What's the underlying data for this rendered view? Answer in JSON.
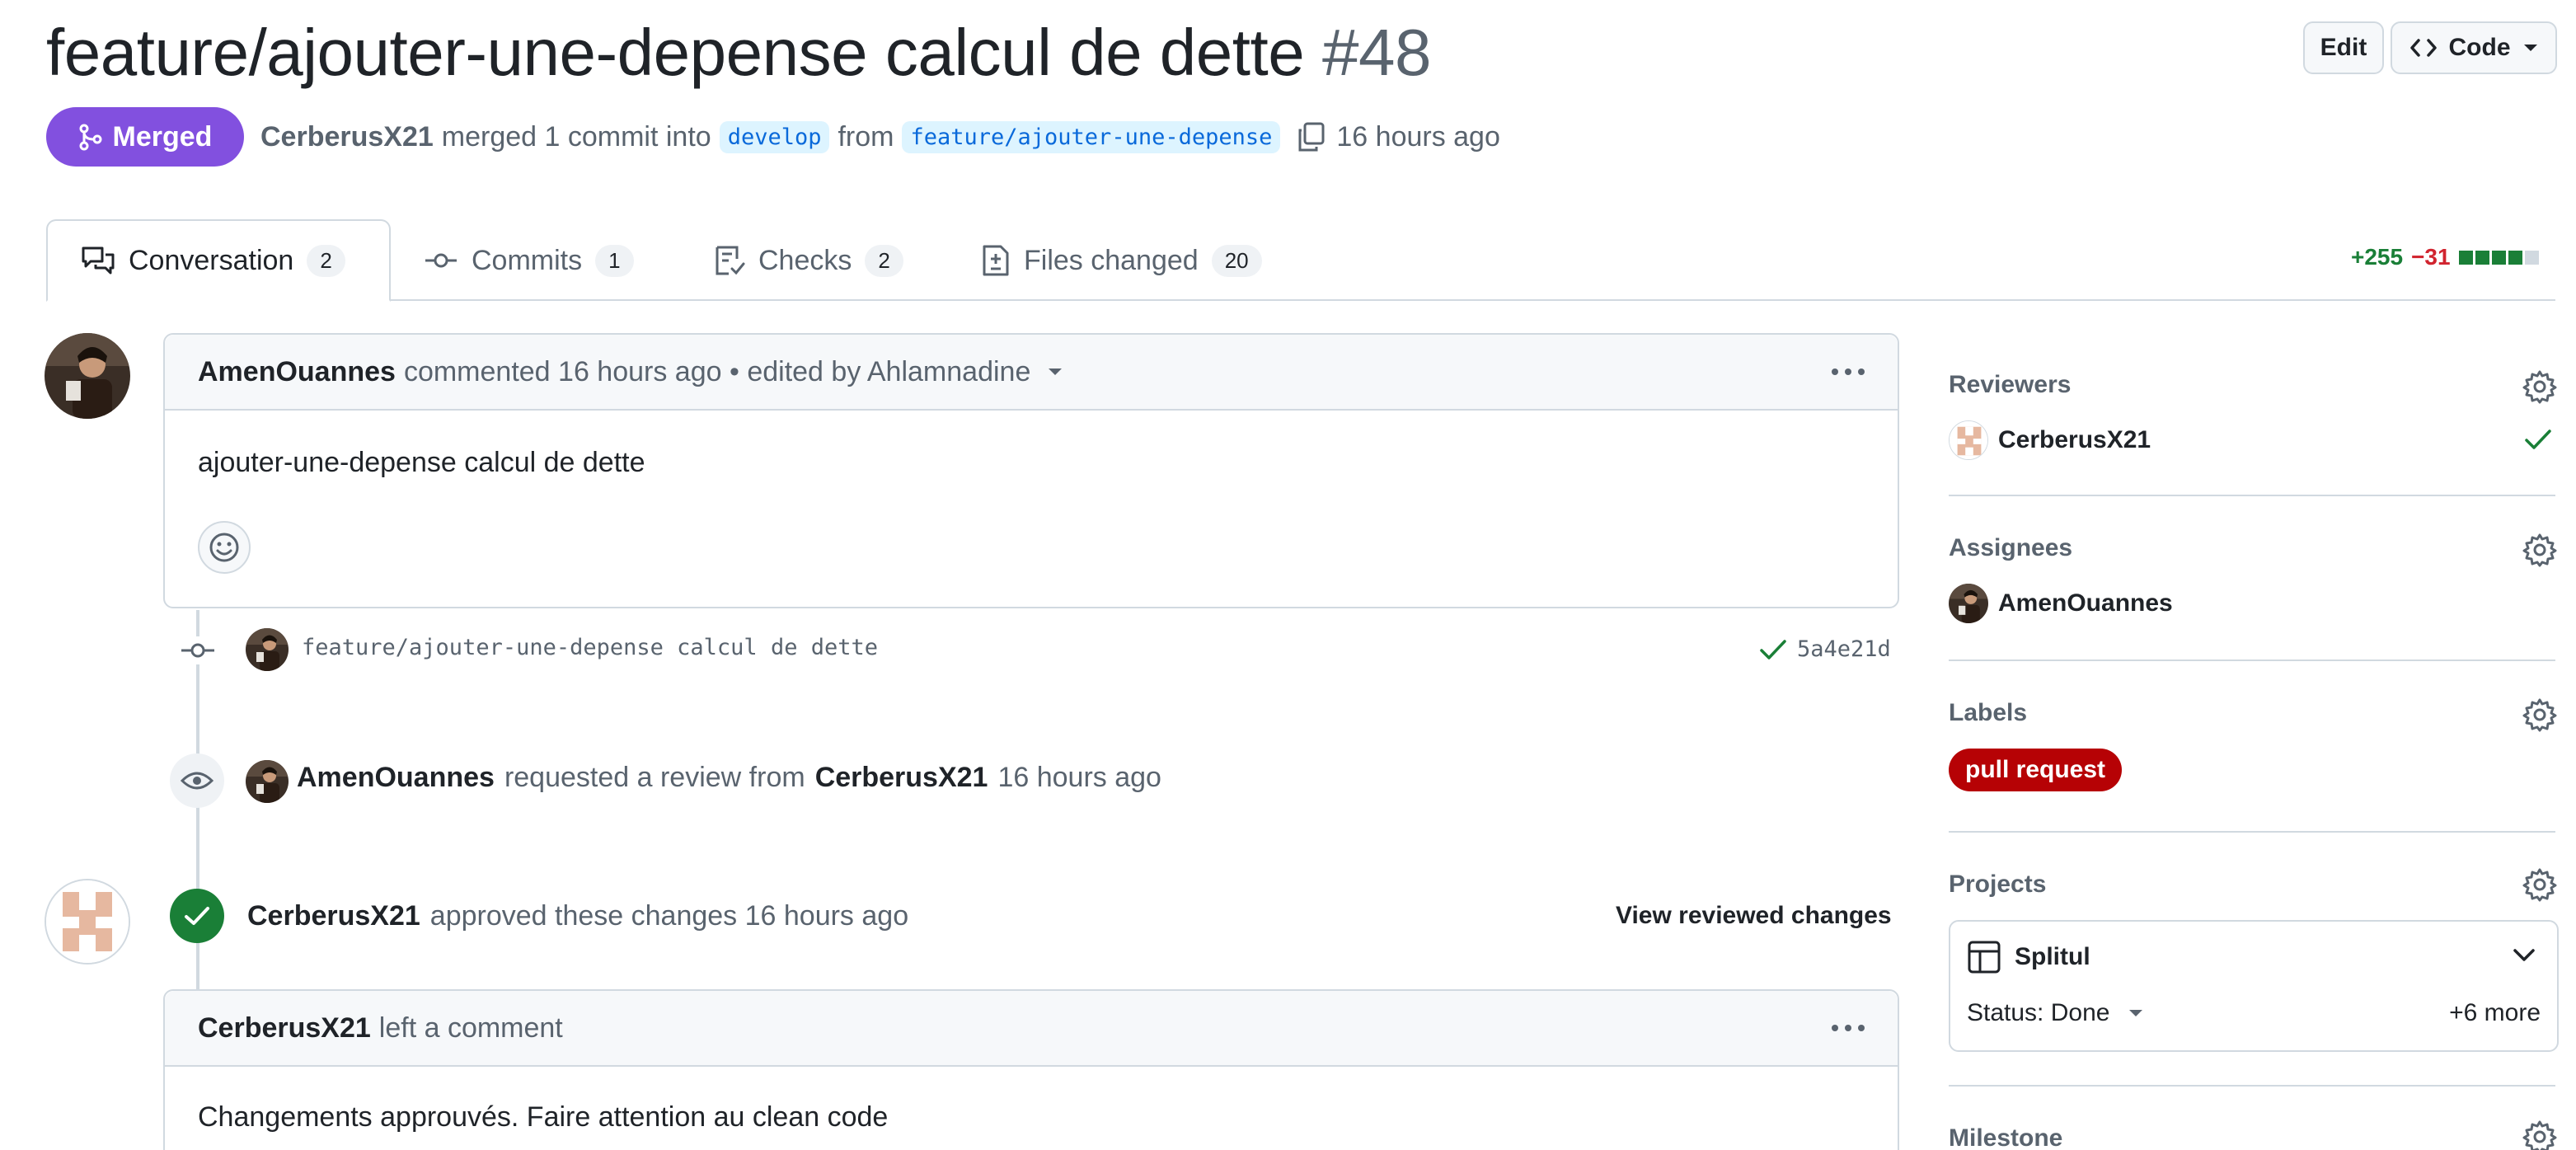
{
  "header": {
    "title": "feature/ajouter-une-depense calcul de dette",
    "number": "#48",
    "edit_label": "Edit",
    "code_label": "Code"
  },
  "status": {
    "badge": "Merged",
    "author": "CerberusX21",
    "merged_text": "merged 1 commit into",
    "base_branch": "develop",
    "from_text": "from",
    "head_branch": "feature/ajouter-une-depense",
    "time": "16 hours ago"
  },
  "tabs": [
    {
      "label": "Conversation",
      "count": "2"
    },
    {
      "label": "Commits",
      "count": "1"
    },
    {
      "label": "Checks",
      "count": "2"
    },
    {
      "label": "Files changed",
      "count": "20"
    }
  ],
  "diffstat": {
    "additions": "+255",
    "deletions": "−31"
  },
  "timeline": {
    "first_comment": {
      "author": "AmenOuannes",
      "meta": "commented 16 hours ago • edited by Ahlamnadine",
      "body": "ajouter-une-depense calcul de dette"
    },
    "commit": {
      "message": "feature/ajouter-une-depense calcul de dette",
      "sha": "5a4e21d"
    },
    "review_request": {
      "actor": "AmenOuannes",
      "text": "requested a review from",
      "target": "CerberusX21",
      "time": "16 hours ago"
    },
    "approval": {
      "actor": "CerberusX21",
      "text": "approved these changes 16 hours ago",
      "link": "View reviewed changes"
    },
    "review_comment": {
      "author": "CerberusX21",
      "meta": "left a comment",
      "body": "Changements approuvés. Faire attention au clean code"
    }
  },
  "sidebar": {
    "reviewers": {
      "title": "Reviewers",
      "name": "CerberusX21"
    },
    "assignees": {
      "title": "Assignees",
      "name": "AmenOuannes"
    },
    "labels": {
      "title": "Labels",
      "label": "pull request",
      "color": "#b60205"
    },
    "projects": {
      "title": "Projects",
      "project": "Splitul",
      "status": "Status: Done",
      "more": "+6 more"
    },
    "milestone": {
      "title": "Milestone"
    }
  },
  "colors": {
    "merged": "#8250df",
    "approved": "#1a7f37",
    "link": "#0969da"
  }
}
